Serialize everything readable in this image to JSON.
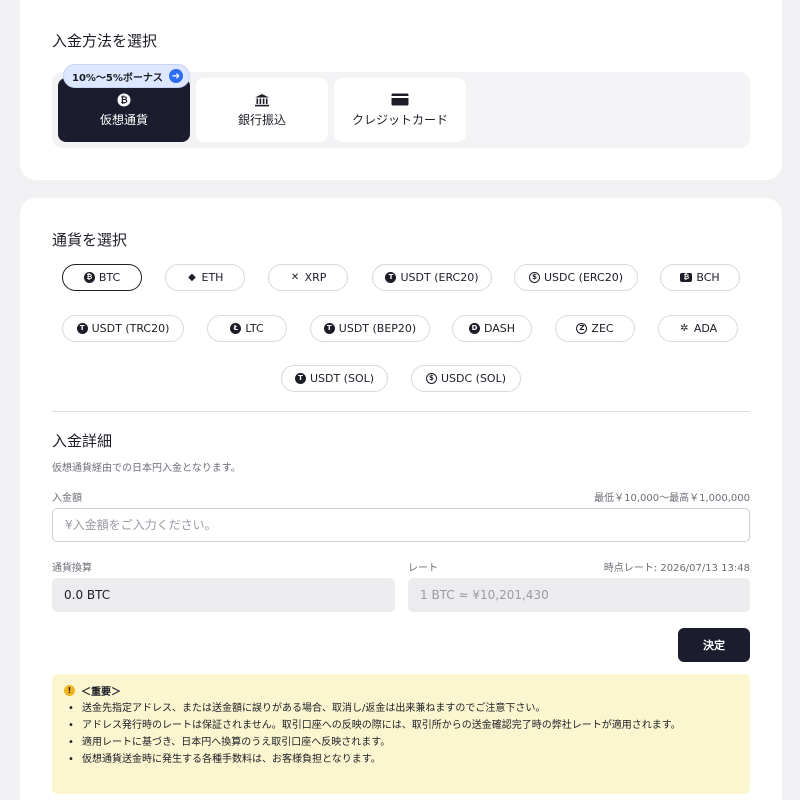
{
  "method_section": {
    "title": "入金方法を選択",
    "bonus_badge": "10%〜5%ボーナス",
    "methods": [
      {
        "label": "仮想通貨",
        "icon": "bitcoin-icon",
        "active": true
      },
      {
        "label": "銀行振込",
        "icon": "bank-icon",
        "active": false
      },
      {
        "label": "クレジットカード",
        "icon": "credit-card-icon",
        "active": false
      }
    ]
  },
  "currency_section": {
    "title": "通貨を選択",
    "currencies": [
      {
        "label": "BTC",
        "icon": "btc-icon",
        "glyph": "₿",
        "active": true
      },
      {
        "label": "ETH",
        "icon": "eth-icon",
        "glyph": "◆"
      },
      {
        "label": "XRP",
        "icon": "xrp-icon",
        "glyph": "✕"
      },
      {
        "label": "USDT (ERC20)",
        "icon": "tether-icon",
        "glyph": "T"
      },
      {
        "label": "USDC (ERC20)",
        "icon": "usdc-icon",
        "glyph": "$"
      },
      {
        "label": "BCH",
        "icon": "bch-icon",
        "glyph": "₿"
      },
      {
        "label": "USDT (TRC20)",
        "icon": "tether-icon",
        "glyph": "T"
      },
      {
        "label": "LTC",
        "icon": "ltc-icon",
        "glyph": "Ł"
      },
      {
        "label": "USDT (BEP20)",
        "icon": "tether-icon",
        "glyph": "T"
      },
      {
        "label": "DASH",
        "icon": "dash-icon",
        "glyph": "D"
      },
      {
        "label": "ZEC",
        "icon": "zec-icon",
        "glyph": "Z"
      },
      {
        "label": "ADA",
        "icon": "ada-icon",
        "glyph": "✲"
      },
      {
        "label": "USDT (SOL)",
        "icon": "tether-icon",
        "glyph": "T"
      },
      {
        "label": "USDC (SOL)",
        "icon": "usdc-icon",
        "glyph": "$"
      }
    ]
  },
  "details": {
    "title": "入金詳細",
    "description": "仮想通貨経由での日本円入金となります。",
    "amount_label": "入金額",
    "amount_limits": "最低￥10,000〜最高￥1,000,000",
    "amount_placeholder": "¥入金額をご入力ください。",
    "conversion_label": "通貨換算",
    "conversion_value": "0.0 BTC",
    "rate_label": "レート",
    "rate_time": "時点レート: 2026/07/13 13:48",
    "rate_value": "1 BTC ≈ ¥10,201,430",
    "submit_label": "決定"
  },
  "notice": {
    "title": "＜重要＞",
    "items": [
      "送金先指定アドレス、または送金額に誤りがある場合、取消し/返金は出来兼ねますのでご注意下さい。",
      "アドレス発行時のレートは保証されません。取引口座への反映の際には、取引所からの送金確認完了時の弊社レートが適用されます。",
      "適用レートに基づき、日本円へ換算のうえ取引口座へ反映されます。",
      "仮想通貨送金時に発生する各種手数料は、お客様負担となります。"
    ]
  },
  "colors": {
    "primary_dark": "#1b1d2e",
    "accent_blue": "#2f6cf5",
    "notice_bg": "#fbf6cf",
    "warn": "#f2b521"
  }
}
